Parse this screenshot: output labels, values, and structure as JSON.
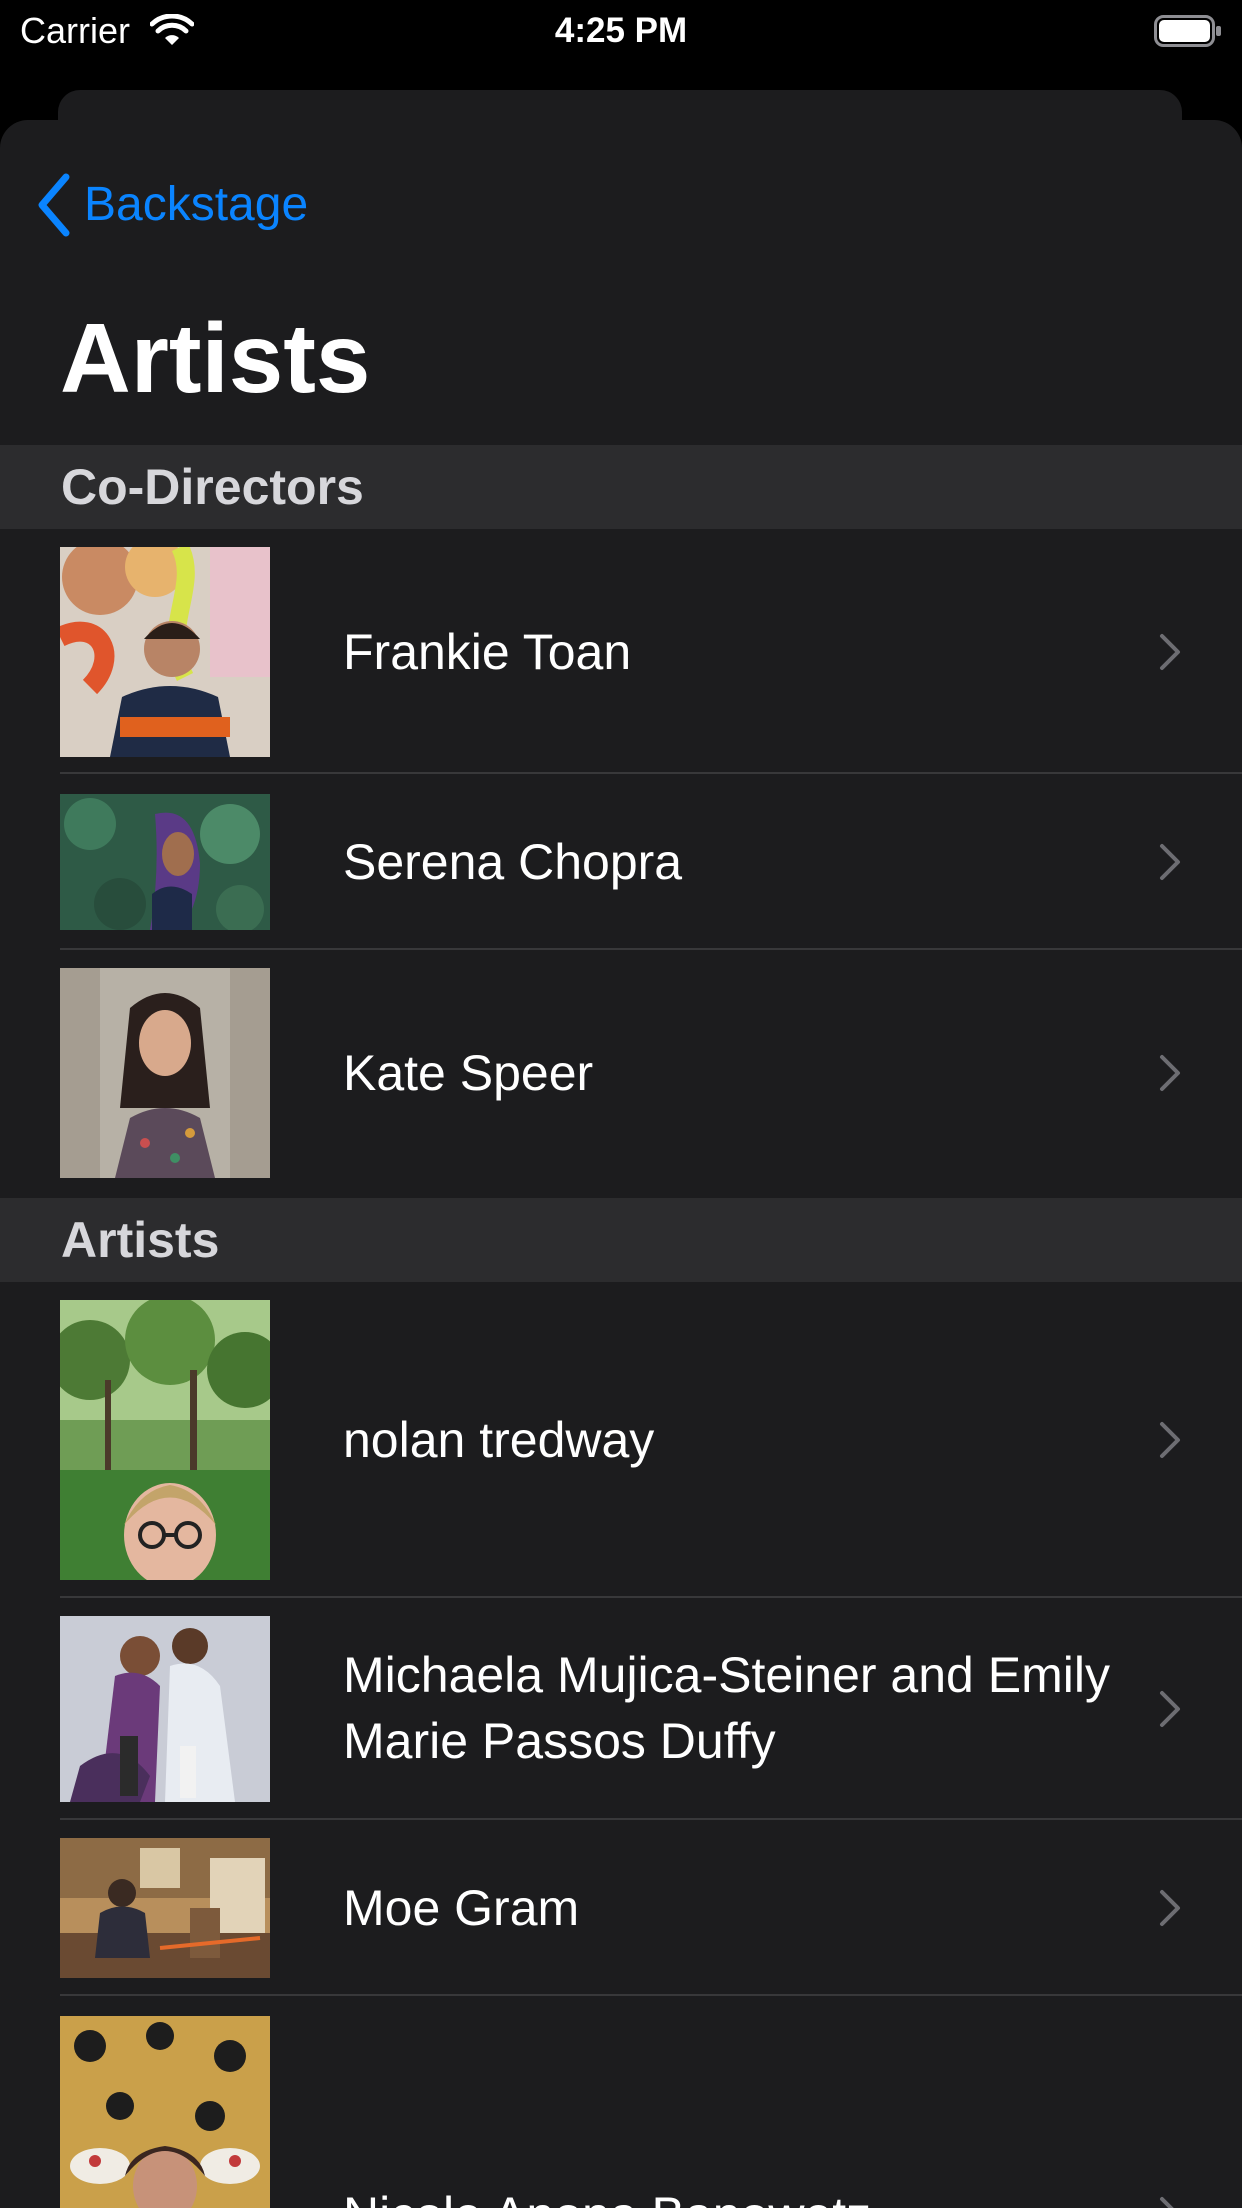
{
  "status_bar": {
    "carrier": "Carrier",
    "time": "4:25 PM"
  },
  "nav": {
    "back_label": "Backstage",
    "title": "Artists"
  },
  "sections": [
    {
      "title": "Co-Directors",
      "rows": [
        {
          "name": "Frankie Toan"
        },
        {
          "name": "Serena Chopra"
        },
        {
          "name": "Kate Speer"
        }
      ]
    },
    {
      "title": "Artists",
      "rows": [
        {
          "name": "nolan tredway"
        },
        {
          "name": "Michaela Mujica-Steiner and Emily Marie Passos Duffy"
        },
        {
          "name": "Moe Gram"
        },
        {
          "name": "Nicole Anona Banowetz"
        }
      ]
    }
  ],
  "colors": {
    "accent": "#0a84ff",
    "background": "#1c1c1e",
    "section_header": "#2c2c2e",
    "separator": "#38383a"
  },
  "icons": {
    "back": "chevron-left-icon",
    "disclosure": "chevron-right-icon",
    "wifi": "wifi-icon",
    "battery": "battery-icon"
  }
}
